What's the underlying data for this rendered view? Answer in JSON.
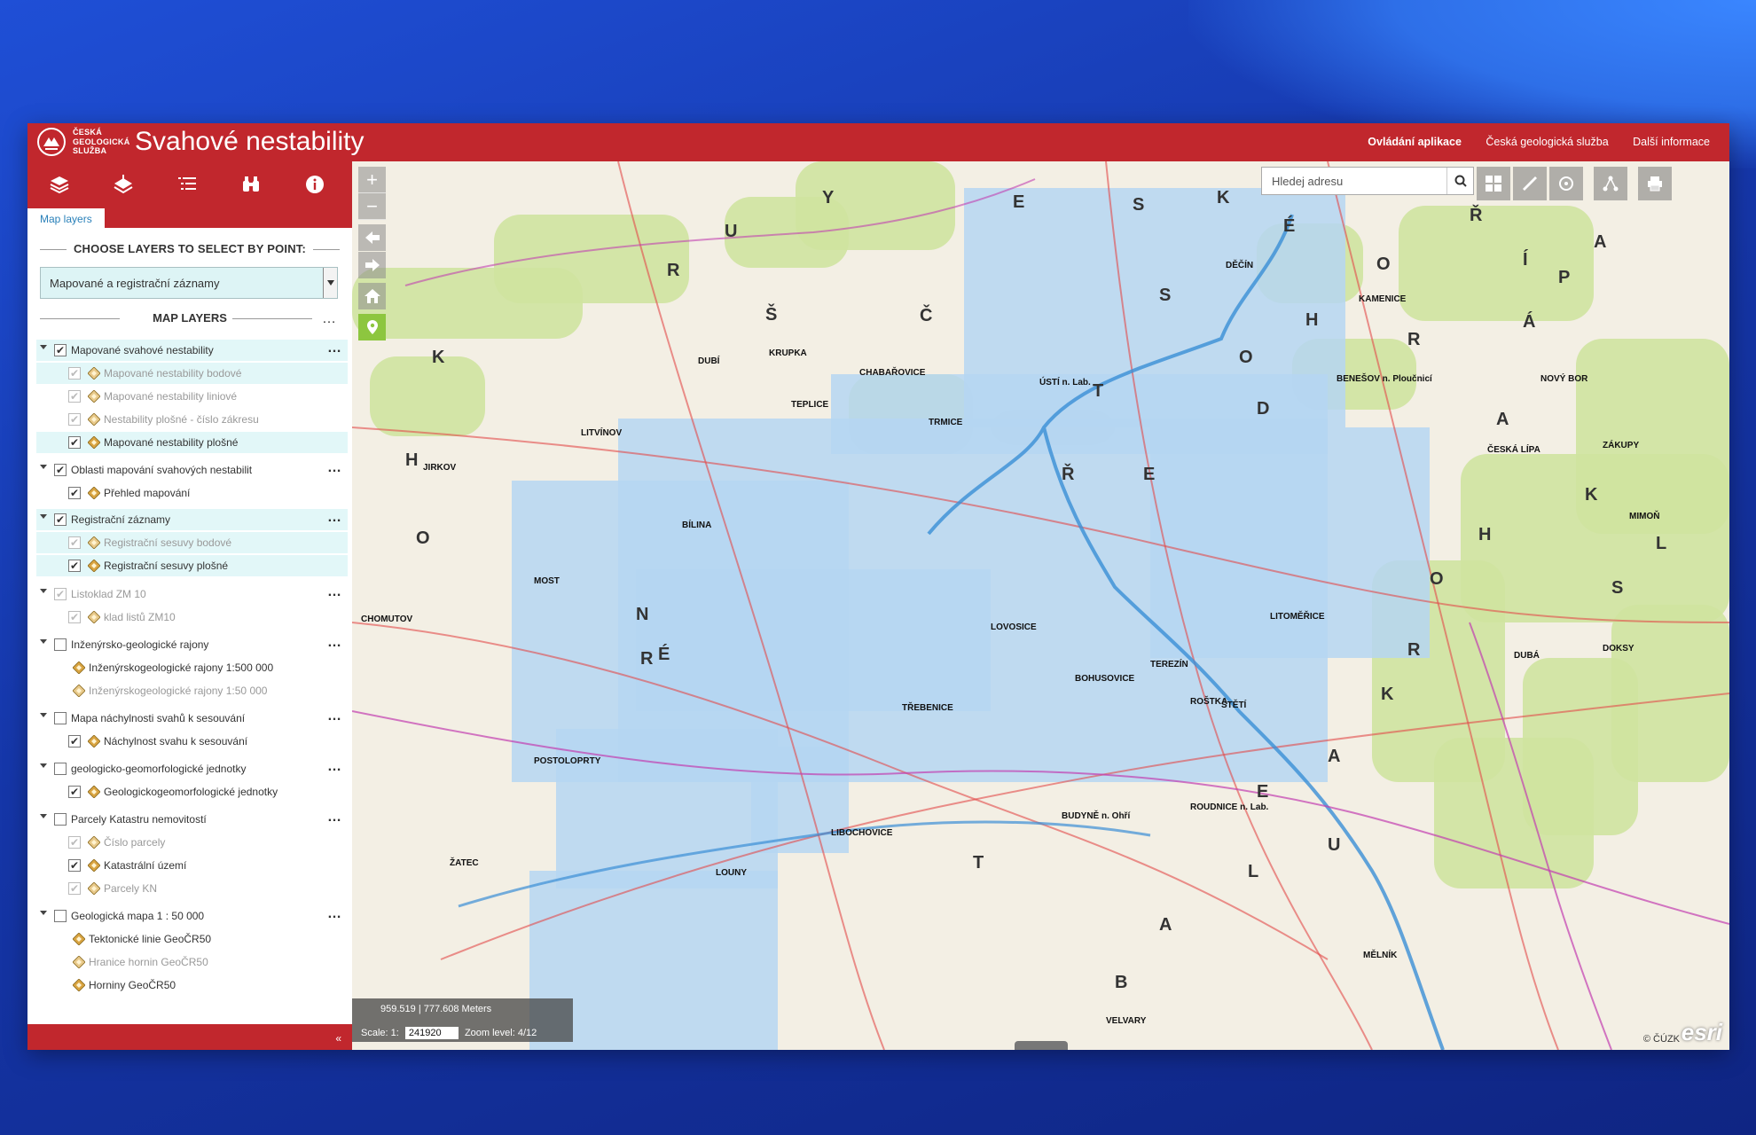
{
  "header": {
    "logo_text": [
      "ČESKÁ",
      "GEOLOGICKÁ",
      "SLUŽBA"
    ],
    "title": "Svahové nestability",
    "links": [
      "Ovládání aplikace",
      "Česká geologická služba",
      "Další informace"
    ]
  },
  "sidebar": {
    "tools": [
      "layers-icon",
      "layer-stack-icon",
      "legend-list-icon",
      "binoculars-icon",
      "info-icon"
    ],
    "tab": "Map layers",
    "choose_title": "CHOOSE LAYERS TO SELECT BY POINT:",
    "choose_value": "Mapované a registrační záznamy",
    "map_layers_title": "MAP LAYERS",
    "layers": [
      {
        "label": "Mapované svahové nestability",
        "level": 0,
        "checked": true,
        "dim": false,
        "hl": true
      },
      {
        "label": "Mapované nestability bodové",
        "level": 1,
        "checked": true,
        "dim": true,
        "hl": true
      },
      {
        "label": "Mapované nestability liniové",
        "level": 1,
        "checked": true,
        "dim": true,
        "hl": false
      },
      {
        "label": "Nestability plošné - číslo zákresu",
        "level": 1,
        "checked": true,
        "dim": true,
        "hl": false
      },
      {
        "label": "Mapované nestability plošné",
        "level": 1,
        "checked": true,
        "dim": false,
        "hl": true
      },
      {
        "label": "Oblasti mapování svahových nestabilit",
        "level": 0,
        "checked": true,
        "dim": false,
        "hl": false
      },
      {
        "label": "Přehled mapování",
        "level": 1,
        "checked": true,
        "dim": false,
        "hl": false
      },
      {
        "label": "Registrační záznamy",
        "level": 0,
        "checked": true,
        "dim": false,
        "hl": true
      },
      {
        "label": "Registrační sesuvy bodové",
        "level": 1,
        "checked": true,
        "dim": true,
        "hl": true
      },
      {
        "label": "Registrační sesuvy plošné",
        "level": 1,
        "checked": true,
        "dim": false,
        "hl": true
      },
      {
        "label": "Listoklad ZM 10",
        "level": 0,
        "checked": true,
        "dim": true,
        "hl": false
      },
      {
        "label": "klad listů ZM10",
        "level": 1,
        "checked": true,
        "dim": true,
        "hl": false
      },
      {
        "label": "Inženýrsko-geologické rajony",
        "level": 0,
        "checked": false,
        "dim": false,
        "hl": false
      },
      {
        "label": "Inženýrskogeologické rajony 1:500 000",
        "level": 2,
        "checked": null,
        "dim": false,
        "hl": false
      },
      {
        "label": "Inženýrskogeologické rajony 1:50 000",
        "level": 2,
        "checked": null,
        "dim": true,
        "hl": false
      },
      {
        "label": "Mapa náchylnosti svahů k sesouvání",
        "level": 0,
        "checked": false,
        "dim": false,
        "hl": false
      },
      {
        "label": "Náchylnost svahu k sesouvání",
        "level": 1,
        "checked": true,
        "dim": false,
        "hl": false
      },
      {
        "label": "geologicko-geomorfologické jednotky",
        "level": 0,
        "checked": false,
        "dim": false,
        "hl": false
      },
      {
        "label": "Geologickogeomorfologické jednotky",
        "level": 1,
        "checked": true,
        "dim": false,
        "hl": false
      },
      {
        "label": "Parcely Katastru nemovitostí",
        "level": 0,
        "checked": false,
        "dim": false,
        "hl": false
      },
      {
        "label": "Číslo parcely",
        "level": 1,
        "checked": true,
        "dim": true,
        "hl": false
      },
      {
        "label": "Katastrální území",
        "level": 1,
        "checked": true,
        "dim": false,
        "hl": false
      },
      {
        "label": "Parcely KN",
        "level": 1,
        "checked": true,
        "dim": true,
        "hl": false
      },
      {
        "label": "Geologická mapa 1 : 50 000",
        "level": 0,
        "checked": false,
        "dim": false,
        "hl": false
      },
      {
        "label": "Tektonické linie GeoČR50",
        "level": 2,
        "checked": null,
        "dim": false,
        "hl": false
      },
      {
        "label": "Hranice hornin GeoČR50",
        "level": 2,
        "checked": null,
        "dim": true,
        "hl": false
      },
      {
        "label": "Horniny GeoČR50",
        "level": 2,
        "checked": null,
        "dim": false,
        "hl": false
      }
    ],
    "collapse_label": "«"
  },
  "map": {
    "search_placeholder": "Hledej adresu",
    "zoom_in": "+",
    "zoom_out": "−",
    "coords": "959.519 | 777.608 Meters",
    "scale_label": "Scale: 1:",
    "scale_value": "241920",
    "zoom_label": "Zoom level:",
    "zoom_value": "4/12",
    "attribution": "© ČÚZK",
    "esri": "esri",
    "places": [
      "DĚČÍN",
      "ÚSTÍ n. Lab.",
      "TEPLICE",
      "LITVÍNOV",
      "MOST",
      "BÍLINA",
      "CHOMUTOV",
      "ŽATEC",
      "LOUNY",
      "LITOMĚŘICE",
      "TEREZÍN",
      "ROUDNICE n. Lab.",
      "MĚLNÍK",
      "ČESKÁ LÍPA",
      "NOVÝ BOR",
      "KRUPKA",
      "DUBÍ",
      "BENEŠOV n. Ploučnicí",
      "ŠTĚTÍ",
      "LIBOCHOVICE",
      "LOVOSICE",
      "TŘEBENICE",
      "POSTOLOPRTY",
      "VELVARY",
      "DOKSY",
      "MIMOŇ",
      "ZÁKUPY",
      "JIRKOV",
      "DUBÁ",
      "CHABAŘOVICE",
      "KAMENICE",
      "TRMICE",
      "BUDYNĚ n. Ohří",
      "ROŠTKA",
      "BOHUSOVICE"
    ],
    "region_letters": [
      "K",
      "R",
      "U",
      "Š",
      "N",
      "É",
      "H",
      "O",
      "R",
      "Y",
      "Č",
      "E",
      "S",
      "K",
      "É",
      "S",
      "T",
      "Ř",
      "E",
      "D",
      "O",
      "H",
      "O",
      "Ř",
      "Í",
      "R",
      "A",
      "L",
      "S",
      "K",
      "Á",
      "P",
      "A",
      "H",
      "O",
      "R",
      "K",
      "A",
      "T",
      "A",
      "B",
      "U",
      "L",
      "E"
    ]
  }
}
